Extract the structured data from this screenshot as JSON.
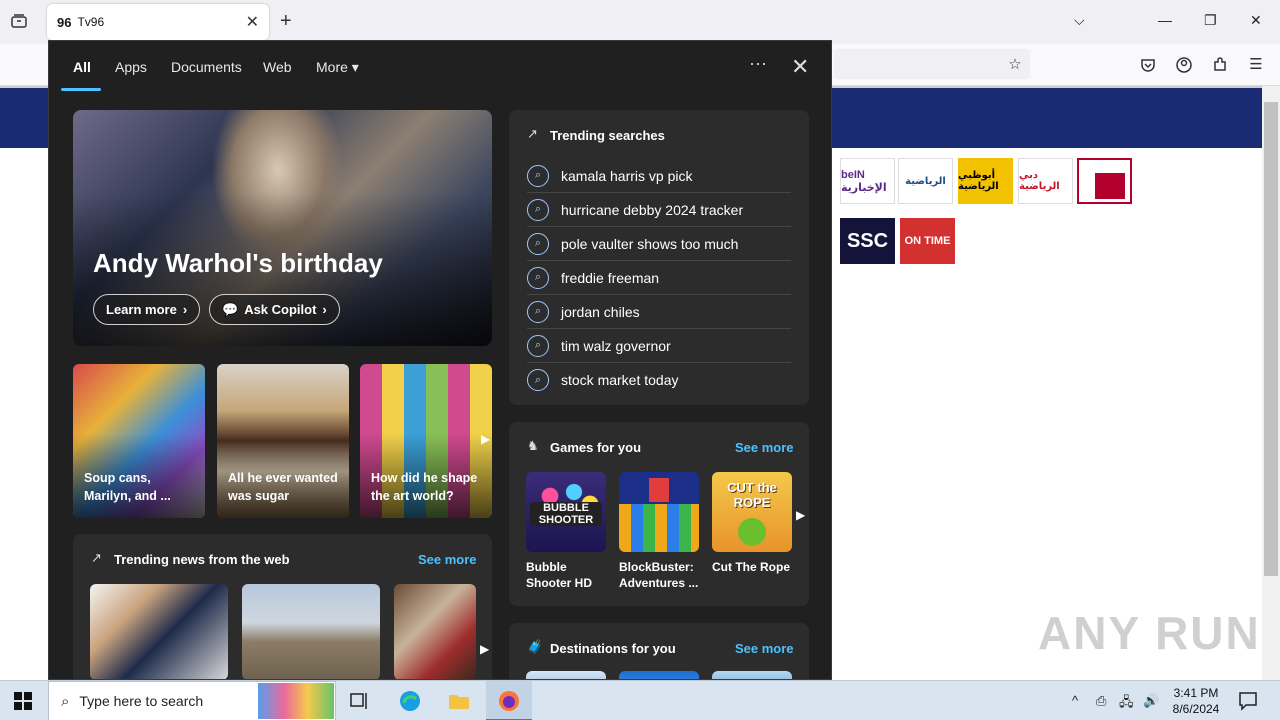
{
  "browser": {
    "tab_title": "Tv96",
    "tab_favicon": "96",
    "new_tab": "+",
    "close_tab": "✕"
  },
  "panel": {
    "tabs": [
      "All",
      "Apps",
      "Documents",
      "Web",
      "More"
    ],
    "active_tab": "All",
    "hero": {
      "title": "Andy Warhol's birthday",
      "learn_more": "Learn more",
      "ask_copilot": "Ask Copilot"
    },
    "cards": [
      {
        "caption": "Soup cans, Marilyn, and ..."
      },
      {
        "caption": "All he ever wanted was sugar"
      },
      {
        "caption": "How did he shape the art world?"
      }
    ],
    "trending": {
      "title": "Trending searches",
      "items": [
        "kamala harris vp pick",
        "hurricane debby 2024 tracker",
        "pole vaulter shows too much",
        "freddie freeman",
        "jordan chiles",
        "tim walz governor",
        "stock market today"
      ]
    },
    "games": {
      "title": "Games for you",
      "see_more": "See more",
      "items": [
        {
          "name": "Bubble Shooter HD",
          "thumb_text": "BUBBLE SHOOTER"
        },
        {
          "name": "BlockBuster: Adventures ...",
          "thumb_text": ""
        },
        {
          "name": "Cut The Rope",
          "thumb_text": "CUT the ROPE"
        }
      ]
    },
    "news": {
      "title": "Trending news from the web",
      "see_more": "See more"
    },
    "destinations": {
      "title": "Destinations for you",
      "see_more": "See more"
    }
  },
  "page": {
    "logos": [
      "beIN الإخبارية",
      "الرياضية",
      "أبوظبي الرياضية",
      "دبي الرياضية",
      "",
      "SSC",
      "ON TIME"
    ],
    "watermark": "ANY RUN"
  },
  "taskbar": {
    "search_placeholder": "Type here to search",
    "time": "3:41 PM",
    "date": "8/6/2024"
  },
  "colors": {
    "panel_bg": "#202020",
    "accent": "#4cc2ff",
    "site_header": "#1b2b73"
  }
}
